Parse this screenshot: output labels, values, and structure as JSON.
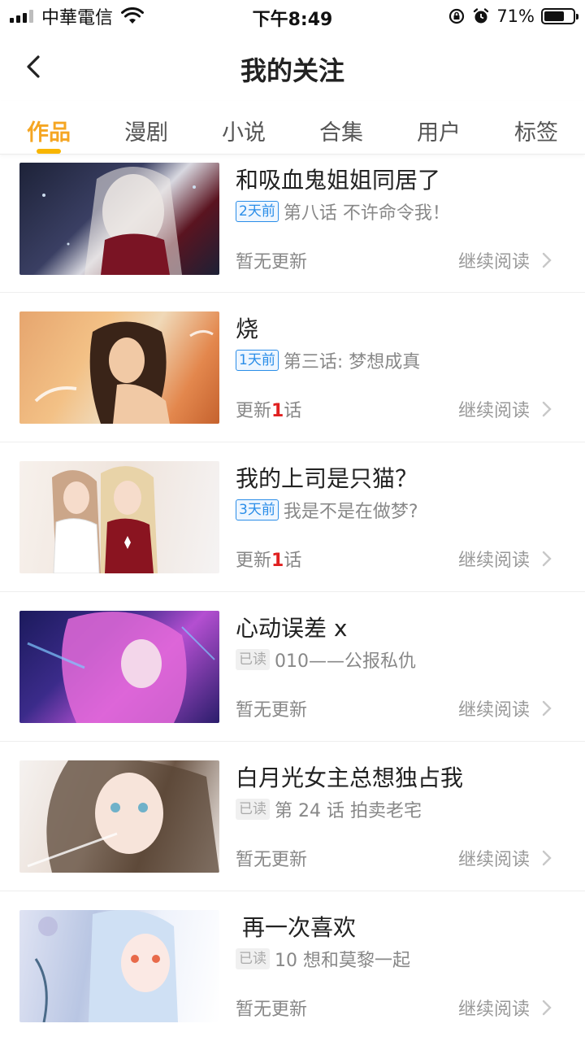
{
  "status_bar": {
    "carrier": "中華電信",
    "time": "下午8:49",
    "battery": "71%",
    "battery_level": 0.71
  },
  "nav": {
    "title": "我的关注"
  },
  "tabs": [
    {
      "label": "作品",
      "active": true
    },
    {
      "label": "漫剧",
      "active": false
    },
    {
      "label": "小说",
      "active": false
    },
    {
      "label": "合集",
      "active": false
    },
    {
      "label": "用户",
      "active": false
    },
    {
      "label": "标签",
      "active": false
    }
  ],
  "continue_label": "继续阅读",
  "items": [
    {
      "title": "和吸血鬼姐姐同居了",
      "badge": "2天前",
      "badge_type": "time",
      "chapter": "第八话 不许命令我！",
      "status_prefix": "暂无更新",
      "status_num": "",
      "status_suffix": ""
    },
    {
      "title": "烧",
      "badge": "1天前",
      "badge_type": "time",
      "chapter": "第三话: 梦想成真",
      "status_prefix": "更新",
      "status_num": "1",
      "status_suffix": "话"
    },
    {
      "title": "我的上司是只猫？",
      "badge": "3天前",
      "badge_type": "time",
      "chapter": "我是不是在做梦?",
      "status_prefix": "更新",
      "status_num": "1",
      "status_suffix": "话"
    },
    {
      "title": "心动误差 x",
      "badge": "已读",
      "badge_type": "read",
      "chapter": "010——公报私仇",
      "status_prefix": "暂无更新",
      "status_num": "",
      "status_suffix": ""
    },
    {
      "title": "白月光女主总想独占我",
      "badge": "已读",
      "badge_type": "read",
      "chapter": "第 24 话 拍卖老宅",
      "status_prefix": "暂无更新",
      "status_num": "",
      "status_suffix": ""
    },
    {
      "title": "再一次喜欢",
      "badge": "已读",
      "badge_type": "read",
      "chapter": "10 想和莫黎一起",
      "status_prefix": "暂无更新",
      "status_num": "",
      "status_suffix": ""
    }
  ],
  "colors": {
    "accent": "#f5a623",
    "badge_blue": "#2a8de8",
    "update_red": "#e02020"
  }
}
